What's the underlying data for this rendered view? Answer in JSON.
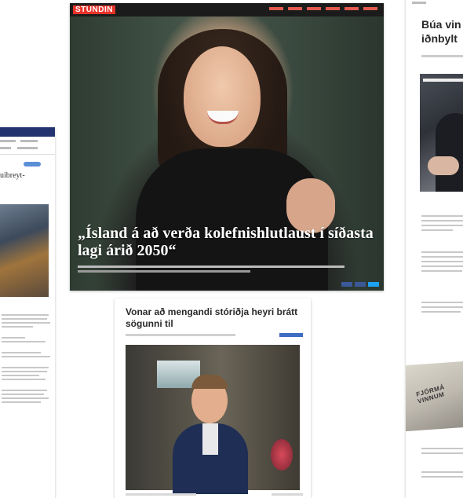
{
  "left_article": {
    "headline": "uibreyt-"
  },
  "main_article": {
    "site_logo": "STUNDIN",
    "headline": "„Ísland á að verða kolefnishlutlaust í síðasta lagi árið 2050“",
    "nav_color": "#e8332a"
  },
  "second_article": {
    "headline": "Vonar að mengandi stóriðja heyri brátt sögunni til"
  },
  "right_article": {
    "headline_line1": "Búa vin",
    "headline_line2": "iðnbylt",
    "sign_text_1": "FJÖRMÁ",
    "sign_text_2": "VINNUM"
  }
}
